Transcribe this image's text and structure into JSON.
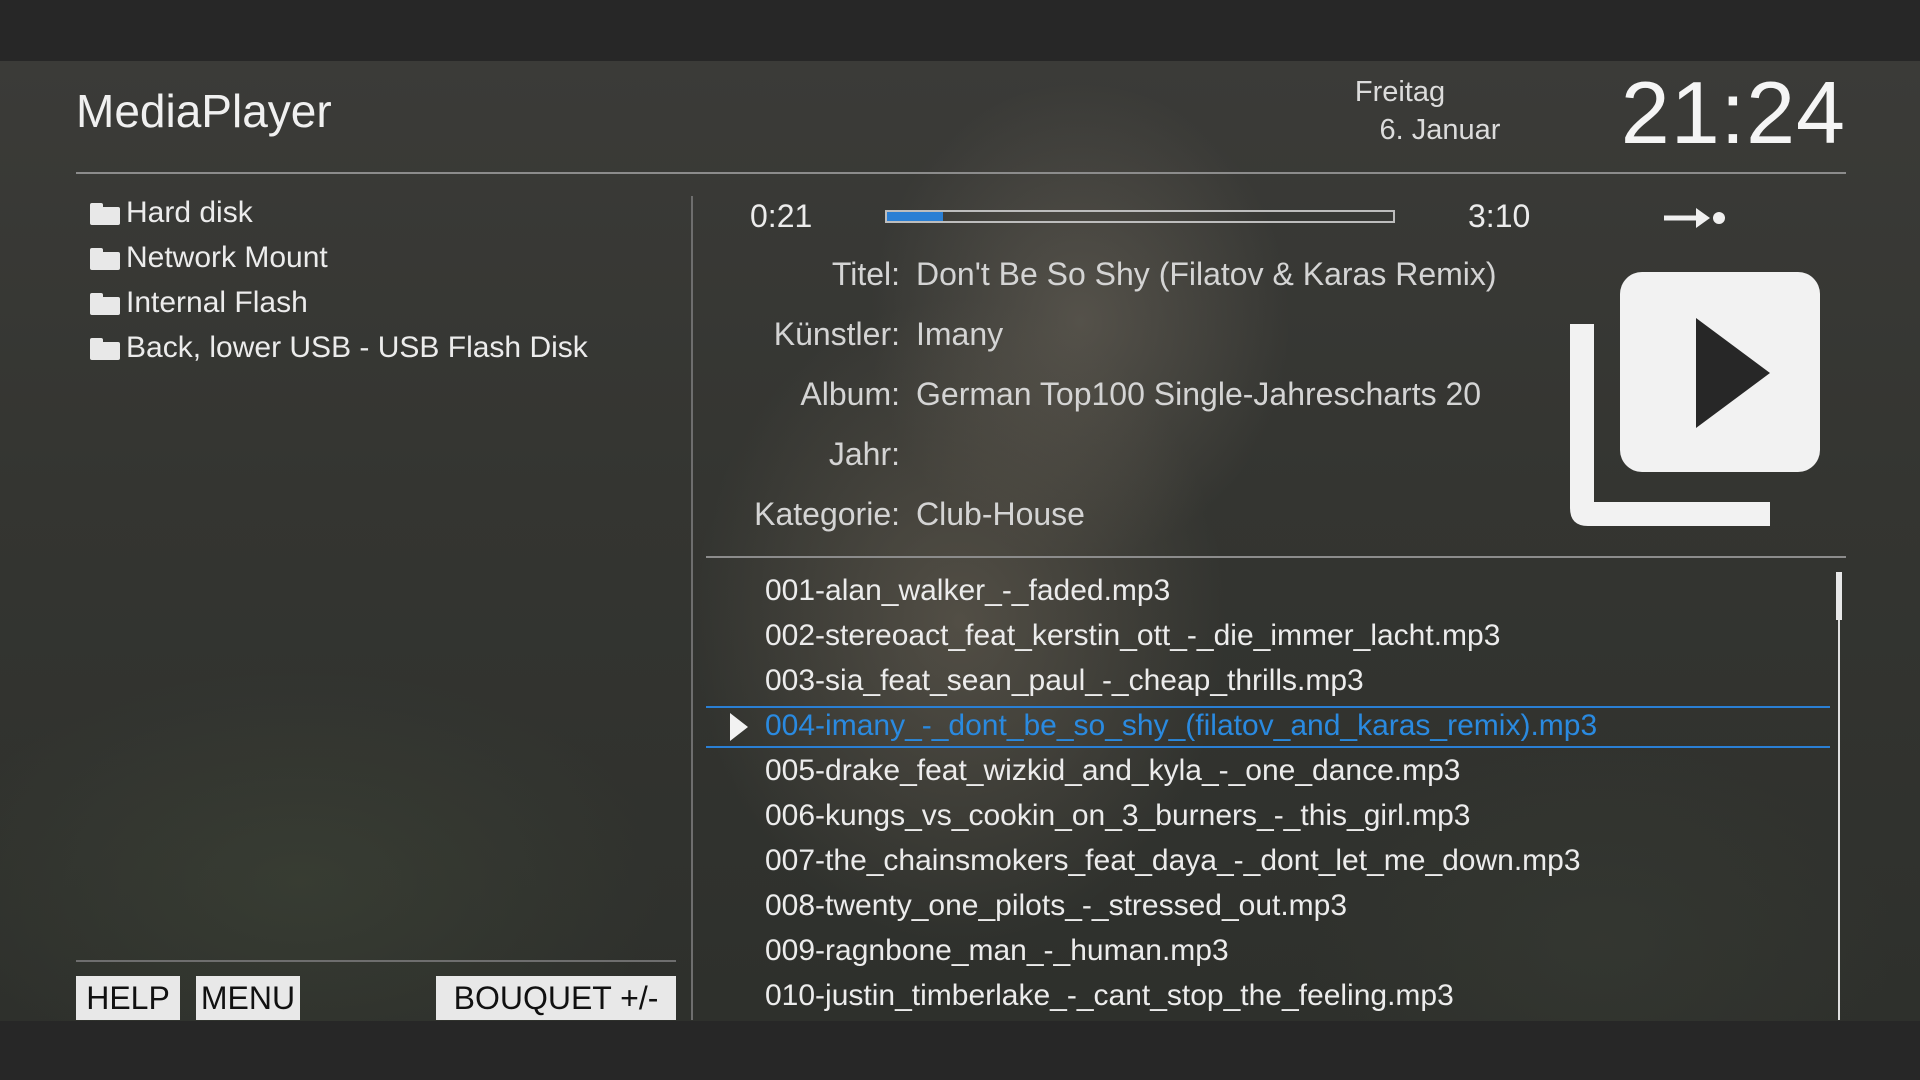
{
  "header": {
    "title": "MediaPlayer",
    "day": "Freitag",
    "date": "6. Januar",
    "clock": "21:24"
  },
  "devices": [
    {
      "label": "Hard disk",
      "icon": "folder-icon"
    },
    {
      "label": "Network Mount",
      "icon": "folder-icon"
    },
    {
      "label": "Internal Flash",
      "icon": "folder-icon"
    },
    {
      "label": "Back, lower USB - USB Flash Disk",
      "icon": "folder-icon"
    }
  ],
  "buttons": {
    "help": "HELP",
    "menu": "MENU",
    "bouquet": "BOUQUET +/-"
  },
  "player": {
    "elapsed": "0:21",
    "total": "3:10",
    "progress_fraction": 0.11,
    "progress_color": "#2a7fd4",
    "repeat_icon": "repeat-mode-icon"
  },
  "metadata": {
    "title_label": "Titel:",
    "title_value": "Don't Be So Shy (Filatov & Karas Remix)",
    "artist_label": "Künstler:",
    "artist_value": "Imany",
    "album_label": "Album:",
    "album_value": "German Top100 Single-Jahrescharts 20",
    "year_label": "Jahr:",
    "year_value": "",
    "genre_label": "Kategorie:",
    "genre_value": "Club-House"
  },
  "cover_icon": "video-library-play-icon",
  "playlist": [
    "001-alan_walker_-_faded.mp3",
    "002-stereoact_feat_kerstin_ott_-_die_immer_lacht.mp3",
    "003-sia_feat_sean_paul_-_cheap_thrills.mp3",
    "004-imany_-_dont_be_so_shy_(filatov_and_karas_remix).mp3",
    "005-drake_feat_wizkid_and_kyla_-_one_dance.mp3",
    "006-kungs_vs_cookin_on_3_burners_-_this_girl.mp3",
    "007-the_chainsmokers_feat_daya_-_dont_let_me_down.mp3",
    "008-twenty_one_pilots_-_stressed_out.mp3",
    "009-ragnbone_man_-_human.mp3",
    "010-justin_timberlake_-_cant_stop_the_feeling.mp3"
  ],
  "playlist_selected_index": 3,
  "accent_color": "#2a8ae0"
}
